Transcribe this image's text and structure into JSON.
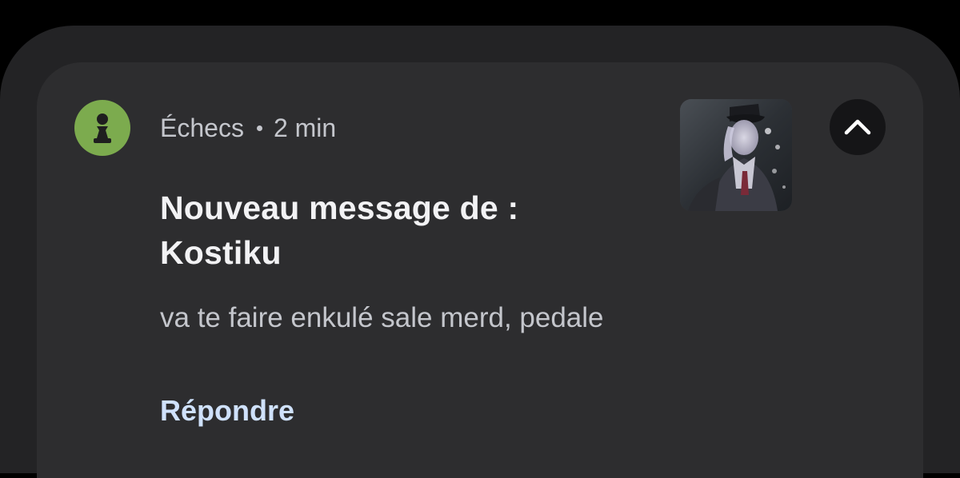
{
  "notification": {
    "app_name": "Échecs",
    "time": "2 min",
    "title_line1": "Nouveau message de :",
    "title_line2": "Kostiku",
    "message": "va te faire enkulé sale merd, pedale",
    "reply_label": "Répondre",
    "app_icon": "chess-pawn-icon",
    "expand_icon": "chevron-up-icon",
    "thumbnail": "sender-avatar-image"
  },
  "colors": {
    "app_icon_bg": "#7cab4e",
    "reply_text": "#cfe1fb",
    "card_bg": "#2d2d2f"
  }
}
